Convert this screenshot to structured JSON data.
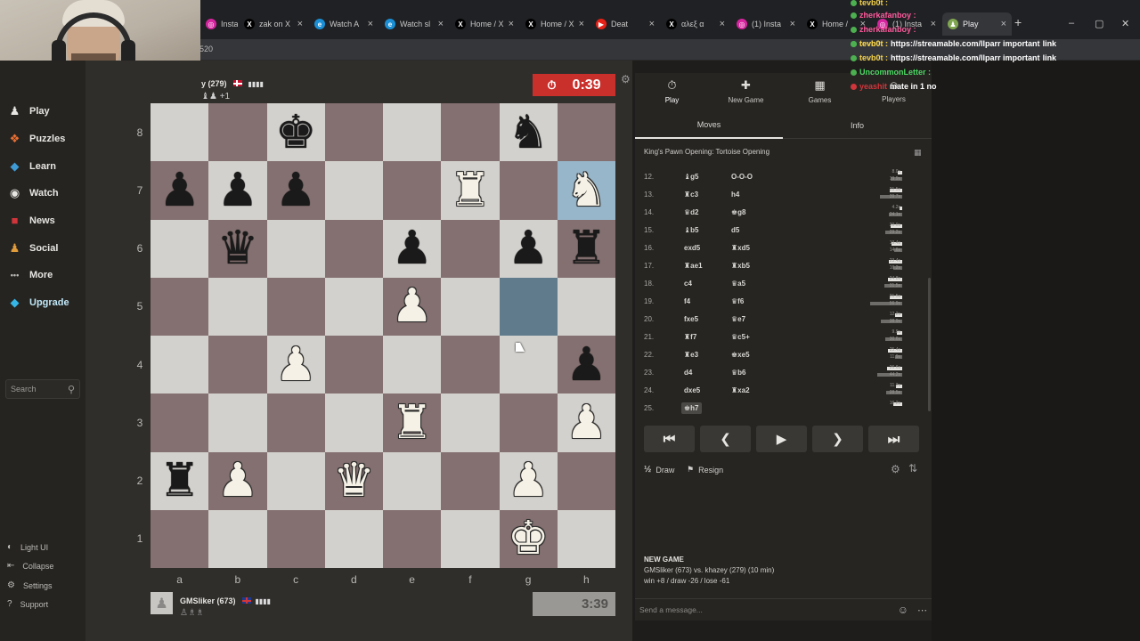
{
  "browser": {
    "tabs": [
      {
        "label": "Insta",
        "fav": "ig"
      },
      {
        "label": "zak on X",
        "fav": "x"
      },
      {
        "label": "Watch A",
        "fav": "edge"
      },
      {
        "label": "Watch sl",
        "fav": "edge"
      },
      {
        "label": "Home / X",
        "fav": "x"
      },
      {
        "label": "Home / X",
        "fav": "x"
      },
      {
        "label": "Deat",
        "fav": "yt"
      },
      {
        "label": "αλεξ α",
        "fav": "x"
      },
      {
        "label": "(1) Insta",
        "fav": "ig"
      },
      {
        "label": "Home /",
        "fav": "x"
      },
      {
        "label": "(1) Insta",
        "fav": "ig"
      },
      {
        "label": "Play",
        "fav": "chess"
      }
    ],
    "new_tab": "+",
    "address_fragment": "520"
  },
  "sidebar": {
    "items": [
      {
        "label": "Play",
        "icon": "pawn-icon",
        "glyph": "♟",
        "color": "#e8e6e3"
      },
      {
        "label": "Puzzles",
        "icon": "puzzle-icon",
        "glyph": "❖",
        "color": "#e96f33"
      },
      {
        "label": "Learn",
        "icon": "learn-icon",
        "glyph": "◆",
        "color": "#3e9bd6"
      },
      {
        "label": "Watch",
        "icon": "binoculars-icon",
        "glyph": "◉",
        "color": "#e8e6e3"
      },
      {
        "label": "News",
        "icon": "news-icon",
        "glyph": "■",
        "color": "#d0353b"
      },
      {
        "label": "Social",
        "icon": "social-icon",
        "glyph": "♟",
        "color": "#e09b3a"
      },
      {
        "label": "More",
        "icon": "more-icon",
        "glyph": "•••",
        "color": "#bdbbb8"
      },
      {
        "label": "Upgrade",
        "icon": "diamond-icon",
        "glyph": "◆",
        "color": "#36b6e6"
      }
    ],
    "search_placeholder": "Search",
    "footer": [
      {
        "label": "Light UI",
        "glyph": "◐"
      },
      {
        "label": "Collapse",
        "glyph": "⇤"
      },
      {
        "label": "Settings",
        "glyph": "⚙"
      },
      {
        "label": "Support",
        "glyph": "?"
      }
    ]
  },
  "top_player": {
    "name": "y (279)",
    "flag": "NO",
    "captured": "♝♟ +1",
    "clock": "0:39"
  },
  "bottom_player": {
    "name": "GMSliker (673)",
    "flag": "GB",
    "captured": "♙♗♗",
    "clock": "3:39"
  },
  "board": {
    "files": [
      "a",
      "b",
      "c",
      "d",
      "e",
      "f",
      "g",
      "h"
    ],
    "ranks": [
      "8",
      "7",
      "6",
      "5",
      "4",
      "3",
      "2",
      "1"
    ],
    "highlights": [
      "g5",
      "h7"
    ],
    "pieces": [
      {
        "sq": "c8",
        "p": "k",
        "color": "b"
      },
      {
        "sq": "g8",
        "p": "n",
        "color": "b"
      },
      {
        "sq": "a7",
        "p": "p",
        "color": "b"
      },
      {
        "sq": "b7",
        "p": "p",
        "color": "b"
      },
      {
        "sq": "c7",
        "p": "p",
        "color": "b"
      },
      {
        "sq": "f7",
        "p": "r",
        "color": "w"
      },
      {
        "sq": "h7",
        "p": "n",
        "color": "w"
      },
      {
        "sq": "b6",
        "p": "q",
        "color": "b"
      },
      {
        "sq": "e6",
        "p": "p",
        "color": "b"
      },
      {
        "sq": "g6",
        "p": "p",
        "color": "b"
      },
      {
        "sq": "h6",
        "p": "r",
        "color": "b"
      },
      {
        "sq": "e5",
        "p": "p",
        "color": "w"
      },
      {
        "sq": "c4",
        "p": "p",
        "color": "w"
      },
      {
        "sq": "h4",
        "p": "p",
        "color": "b"
      },
      {
        "sq": "e3",
        "p": "r",
        "color": "w"
      },
      {
        "sq": "h3",
        "p": "p",
        "color": "w"
      },
      {
        "sq": "a2",
        "p": "r",
        "color": "b"
      },
      {
        "sq": "b2",
        "p": "p",
        "color": "w"
      },
      {
        "sq": "d2",
        "p": "q",
        "color": "w"
      },
      {
        "sq": "g2",
        "p": "p",
        "color": "w"
      },
      {
        "sq": "g1",
        "p": "k",
        "color": "w"
      }
    ]
  },
  "right_panel": {
    "top_tabs": [
      {
        "label": "Play",
        "glyph": "⏱"
      },
      {
        "label": "New Game",
        "glyph": "✚"
      },
      {
        "label": "Games",
        "glyph": "▦"
      },
      {
        "label": "Players",
        "glyph": "☺"
      }
    ],
    "sub_tabs": {
      "moves": "Moves",
      "info": "Info"
    },
    "opening": "King's Pawn Opening: Tortoise Opening",
    "moves": [
      {
        "n": "12.",
        "w": "♝g5",
        "b": "O-O-O",
        "wt": "8.0s",
        "bt": "19.9s",
        "wf": 0.14,
        "bf": 0.35
      },
      {
        "n": "13.",
        "w": "♜c3",
        "b": "h4",
        "wt": "21.5s",
        "bt": "39.7s",
        "wf": 0.38,
        "bf": 0.7
      },
      {
        "n": "14.",
        "w": "♛d2",
        "b": "♚g8",
        "wt": "4.2s",
        "bt": "24.1s",
        "wf": 0.08,
        "bf": 0.43
      },
      {
        "n": "15.",
        "w": "♝b5",
        "b": "d5",
        "wt": "20.0s",
        "bt": "29.2s",
        "wf": 0.35,
        "bf": 0.52
      },
      {
        "n": "16.",
        "w": "exd5",
        "b": "♜xd5",
        "wt": "19.4s",
        "bt": "14.6s",
        "wf": 0.34,
        "bf": 0.26
      },
      {
        "n": "17.",
        "w": "♜ae1",
        "b": "♜xb5",
        "wt": "23.4s",
        "bt": "16.2s",
        "wf": 0.41,
        "bf": 0.29
      },
      {
        "n": "18.",
        "w": "c4",
        "b": "♛a5",
        "wt": "24.8s",
        "bt": "31.5s",
        "wf": 0.44,
        "bf": 0.56
      },
      {
        "n": "19.",
        "w": "f4",
        "b": "♛f6",
        "wt": "21.5s",
        "bt": "56.9s",
        "wf": 0.38,
        "bf": 1.0
      },
      {
        "n": "20.",
        "w": "fxe5",
        "b": "♛e7",
        "wt": "12.2s",
        "bt": "38.9s",
        "wf": 0.21,
        "bf": 0.68
      },
      {
        "n": "21.",
        "w": "♜f7",
        "b": "♛c5+",
        "wt": "9.9s",
        "bt": "30.6s",
        "wf": 0.17,
        "bf": 0.54
      },
      {
        "n": "22.",
        "w": "♜e3",
        "b": "♚xe5",
        "wt": "25.4s",
        "bt": "11.9s",
        "wf": 0.45,
        "bf": 0.21
      },
      {
        "n": "23.",
        "w": "d4",
        "b": "♛b6",
        "wt": "26.6s",
        "bt": "44.2s",
        "wf": 0.47,
        "bf": 0.78
      },
      {
        "n": "24.",
        "w": "dxe5",
        "b": "♜xa2",
        "wt": "11.2s",
        "bt": "28.5s",
        "wf": 0.2,
        "bf": 0.5
      },
      {
        "n": "25.",
        "w": "♚h7",
        "b": "",
        "wt": "16.2s",
        "bt": "",
        "wf": 0.28,
        "bf": 0
      }
    ],
    "nav": [
      "⏮",
      "❮",
      "▶",
      "❯",
      "⏭"
    ],
    "draw_label": "Draw",
    "resign_label": "Resign",
    "new_game": {
      "title": "NEW GAME",
      "line1": "GMSliker (673) vs. khazey (279) (10 min)",
      "line2": "win +8 / draw -26 / lose -61"
    },
    "chat_placeholder": "Send a message..."
  },
  "chat_overlay": [
    {
      "user": "tevb0t :",
      "msg": "",
      "color": "#f2d14b"
    },
    {
      "user": "zherkafanboy :",
      "msg": "",
      "color": "#ff5a9d"
    },
    {
      "user": "tevb0t :",
      "msg": "",
      "color": "#f2d14b"
    },
    {
      "user": "zherkafanboy :",
      "msg": "",
      "color": "#ff5a9d"
    },
    {
      "user": "tevb0t :",
      "msg": "https://streamable.com/llparr important",
      "color": "#f2d14b",
      "tail": "link"
    },
    {
      "user": "tevb0t :",
      "msg": "https://streamable.com/llparr important",
      "color": "#f2d14b",
      "tail": "link"
    },
    {
      "user": "UncommonLetter :",
      "msg": "",
      "color": "#4cd964"
    },
    {
      "user": "yeashit",
      "msg": "mate in 1 no",
      "color": "#d0353b"
    }
  ],
  "colors": {
    "clock_red": "#c9302c",
    "board_light": "#d3d1cd",
    "board_dark": "#847070"
  }
}
